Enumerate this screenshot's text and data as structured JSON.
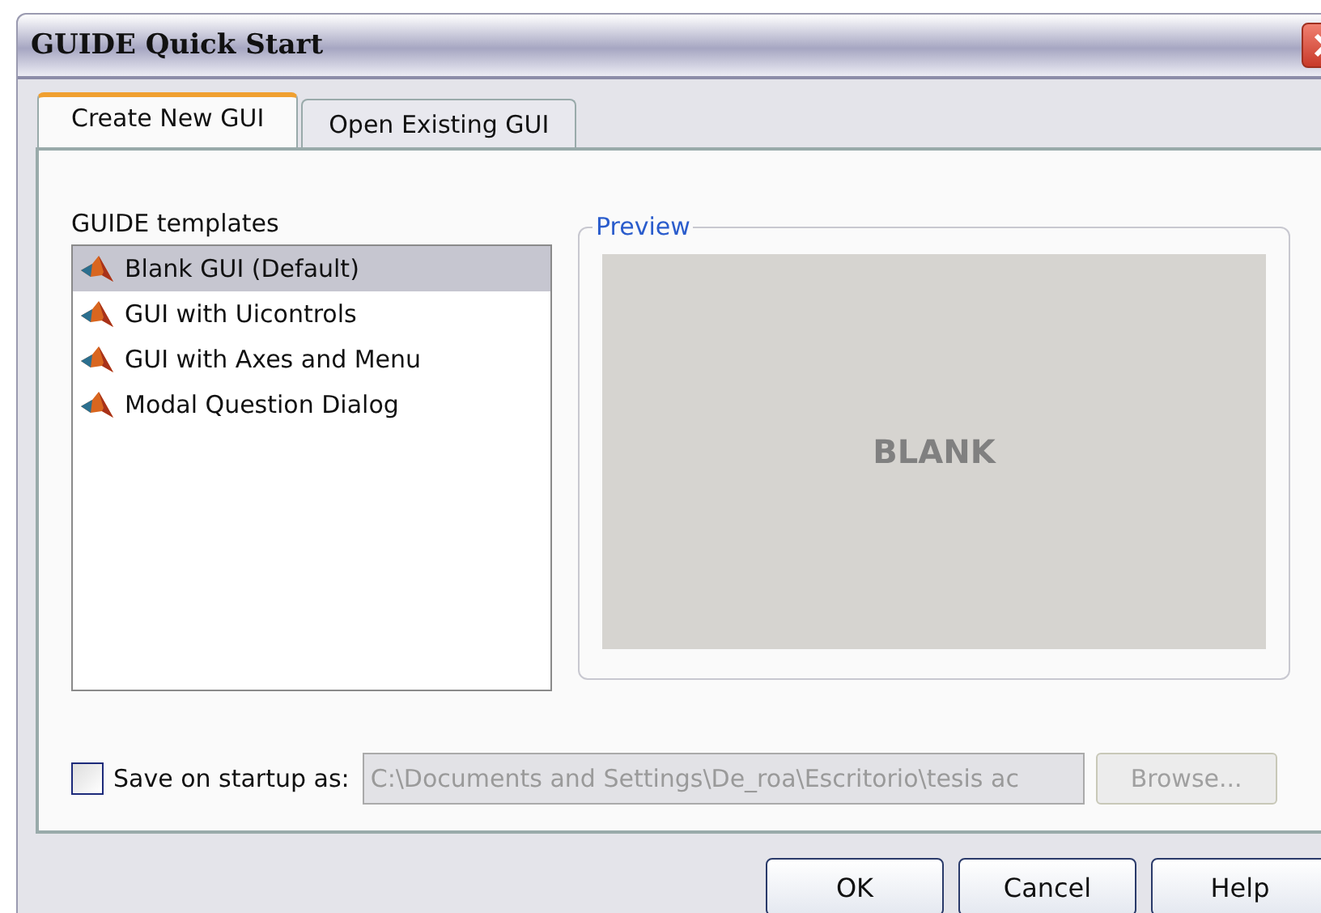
{
  "window": {
    "title": "GUIDE Quick Start"
  },
  "tabs": [
    {
      "label": "Create New GUI",
      "selected": true
    },
    {
      "label": "Open Existing GUI",
      "selected": false
    }
  ],
  "templates": {
    "label": "GUIDE templates",
    "items": [
      {
        "label": "Blank GUI (Default)",
        "selected": true
      },
      {
        "label": "GUI with Uicontrols",
        "selected": false
      },
      {
        "label": "GUI with Axes and Menu",
        "selected": false
      },
      {
        "label": "Modal Question Dialog",
        "selected": false
      }
    ]
  },
  "preview": {
    "legend": "Preview",
    "text": "BLANK"
  },
  "save": {
    "label": "Save on startup as:",
    "checked": false,
    "value": "C:\\Documents and Settings\\De_roa\\Escritorio\\tesis ac",
    "disabled": true,
    "browse": {
      "label": "Browse...",
      "disabled": true
    }
  },
  "buttons": [
    "OK",
    "Cancel",
    "Help"
  ]
}
